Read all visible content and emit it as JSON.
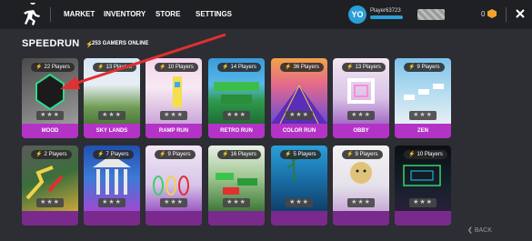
{
  "nav": {
    "market": "MARKET",
    "inventory": "INVENTORY",
    "store": "STORE",
    "settings": "SETTINGS"
  },
  "user": {
    "avatar_initials": "YO",
    "name": "Player63723",
    "coins": "0"
  },
  "header": {
    "title": "SPEEDRUN",
    "online": "253 GAMERS ONLINE"
  },
  "cards": [
    {
      "name": "MOOD",
      "players": "22 Players",
      "stars": "★★★"
    },
    {
      "name": "SKY LANDS",
      "players": "13 Players",
      "stars": "★★★"
    },
    {
      "name": "RAMP RUN",
      "players": "10 Players",
      "stars": "★★★"
    },
    {
      "name": "RETRO RUN",
      "players": "14 Players",
      "stars": "★★★"
    },
    {
      "name": "COLOR RUN",
      "players": "36 Players",
      "stars": "★★★"
    },
    {
      "name": "OBBY",
      "players": "13 Players",
      "stars": "★★★"
    },
    {
      "name": "ZEN",
      "players": "9 Players",
      "stars": "★★★"
    },
    {
      "name": "",
      "players": "2 Players",
      "stars": "★★★"
    },
    {
      "name": "",
      "players": "7 Players",
      "stars": "★★★"
    },
    {
      "name": "",
      "players": "9 Players",
      "stars": "★★★"
    },
    {
      "name": "",
      "players": "16 Players",
      "stars": "★★★"
    },
    {
      "name": "",
      "players": "5 Players",
      "stars": "★★★"
    },
    {
      "name": "",
      "players": "9 Players",
      "stars": "★★★"
    },
    {
      "name": "",
      "players": "10 Players",
      "stars": "★★★"
    }
  ],
  "footer": {
    "back": "BACK",
    "back_icon": "back-chevron-icon"
  },
  "colors": {
    "accent": "#b433c7",
    "online": "#4cd964",
    "avatar": "#2a9fd8",
    "coin": "#f3a32a",
    "arrow": "#e0302f"
  }
}
